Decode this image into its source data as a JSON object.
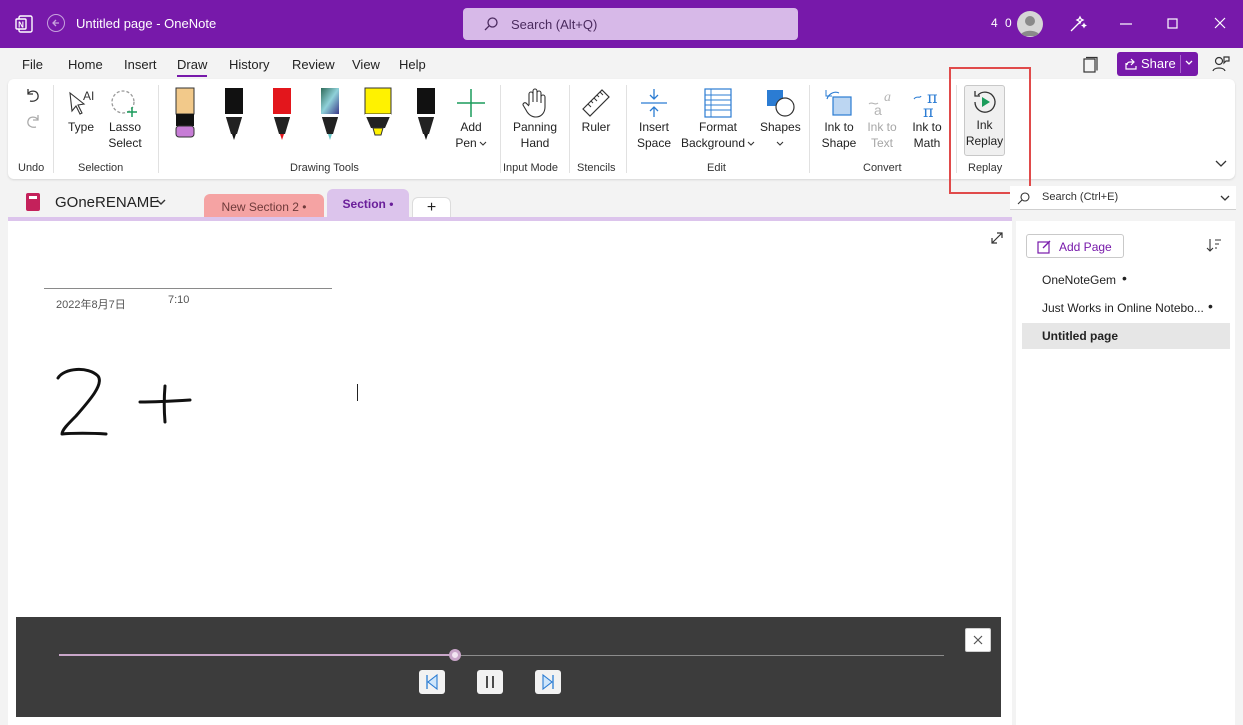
{
  "window": {
    "title": "Untitled page  -  OneNote",
    "search_placeholder": "Search (Alt+Q)",
    "count": "4 0"
  },
  "menu": {
    "tabs": [
      "File",
      "Home",
      "Insert",
      "Draw",
      "History",
      "Review",
      "View",
      "Help"
    ],
    "active": "Draw",
    "share_label": "Share"
  },
  "ribbon": {
    "undo_group": "Undo",
    "selection": {
      "type": "Type",
      "lasso1": "Lasso",
      "lasso2": "Select",
      "group": "Selection"
    },
    "drawing_tools": {
      "group": "Drawing Tools",
      "add_pen1": "Add",
      "add_pen2": "Pen"
    },
    "input_mode": {
      "b1": "Panning",
      "b2": "Hand",
      "group": "Input Mode"
    },
    "stencils": {
      "b": "Ruler",
      "group": "Stencils"
    },
    "edit": {
      "insert1": "Insert",
      "insert2": "Space",
      "format1": "Format",
      "format2": "Background",
      "shapes": "Shapes",
      "group": "Edit"
    },
    "convert": {
      "ink_shape1": "Ink to",
      "ink_shape2": "Shape",
      "ink_text1": "Ink to",
      "ink_text2": "Text",
      "ink_math1": "Ink to",
      "ink_math2": "Math",
      "group": "Convert"
    },
    "replay": {
      "b1": "Ink",
      "b2": "Replay",
      "group": "Replay"
    }
  },
  "notebook": {
    "name": "GOneRENAME",
    "sections": [
      {
        "label": "New Section 2 •",
        "color": "#f5a3a3"
      },
      {
        "label": "Section •",
        "color": "#dcc4ec"
      }
    ],
    "add_section": "+"
  },
  "page": {
    "date": "2022年8月7日",
    "time": "7:10"
  },
  "right_pane": {
    "search_placeholder": "Search (Ctrl+E)",
    "add_page": "Add Page",
    "pages": [
      {
        "title": "OneNoteGem",
        "dot": "•"
      },
      {
        "title": "Just Works in Online Notebo...",
        "dot": "•"
      },
      {
        "title": "Untitled page",
        "dot": ""
      }
    ]
  },
  "replay_bar": {
    "progress": 0.447
  },
  "colors": {
    "accent": "#7719aa",
    "highlight": "#e04a4a"
  }
}
